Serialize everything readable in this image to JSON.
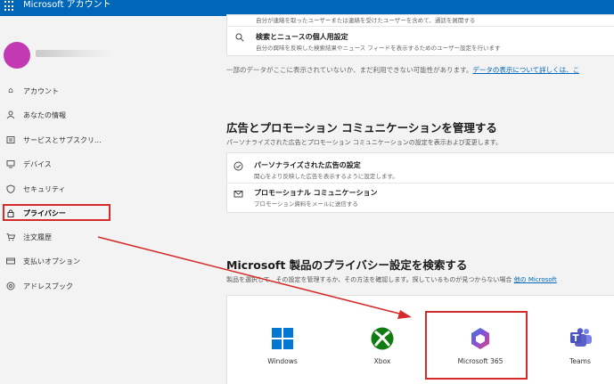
{
  "header": {
    "brand": "Microsoft アカウント"
  },
  "sidebar": {
    "avatar_initials": "",
    "items": [
      {
        "label": "アカウント",
        "icon": "home-icon"
      },
      {
        "label": "あなたの情報",
        "icon": "person-icon"
      },
      {
        "label": "サービスとサブスクリ...",
        "icon": "subscriptions-icon"
      },
      {
        "label": "デバイス",
        "icon": "device-icon"
      },
      {
        "label": "セキュリティ",
        "icon": "shield-icon"
      },
      {
        "label": "プライバシー",
        "icon": "lock-icon"
      },
      {
        "label": "注文履歴",
        "icon": "cart-icon"
      },
      {
        "label": "支払いオプション",
        "icon": "card-icon"
      },
      {
        "label": "アドレスブック",
        "icon": "location-icon"
      }
    ]
  },
  "main": {
    "top_card": {
      "first_row_sub": "自分が連絡を取ったユーザーまたは連絡を受けたユーザーを含めて、通話を展開する",
      "search_row_title": "検索とニュースの個人用設定",
      "search_row_sub": "自分の興味を反映した検索結果やニュース フィードを表示するためのユーザー設定を行います"
    },
    "note": "一部のデータがここに表示されていないか、まだ利用できない可能性があります。",
    "note_link": "データの表示について詳しくは、こ",
    "ads": {
      "title": "広告とプロモーション コミュニケーションを管理する",
      "desc": "パーソナライズされた広告とプロモーション コミュニケーションの設定を表示および変更します。",
      "rows": [
        {
          "title": "パーソナライズされた広告の設定",
          "sub": "関心をより反映した広告を表示するように設定します。",
          "icon": "check-circle-icon"
        },
        {
          "title": "プロモーショナル コミュニケーション",
          "sub": "プロモーション資料をメールに送信する",
          "icon": "mail-icon"
        }
      ]
    },
    "products": {
      "title": "Microsoft 製品のプライバシー設定を検索する",
      "desc": "製品を選択して、その設定を管理するか、その方法を確認します。探しているものが見つからない場合",
      "desc_link": "他の Microsoft",
      "items": [
        {
          "name": "Windows",
          "icon": "windows-logo-icon"
        },
        {
          "name": "Xbox",
          "icon": "xbox-logo-icon"
        },
        {
          "name": "Microsoft 365",
          "icon": "m365-logo-icon"
        },
        {
          "name": "Teams",
          "icon": "teams-logo-icon"
        }
      ]
    }
  },
  "colors": {
    "accent": "#0067b8",
    "highlight": "#d42a2a"
  }
}
